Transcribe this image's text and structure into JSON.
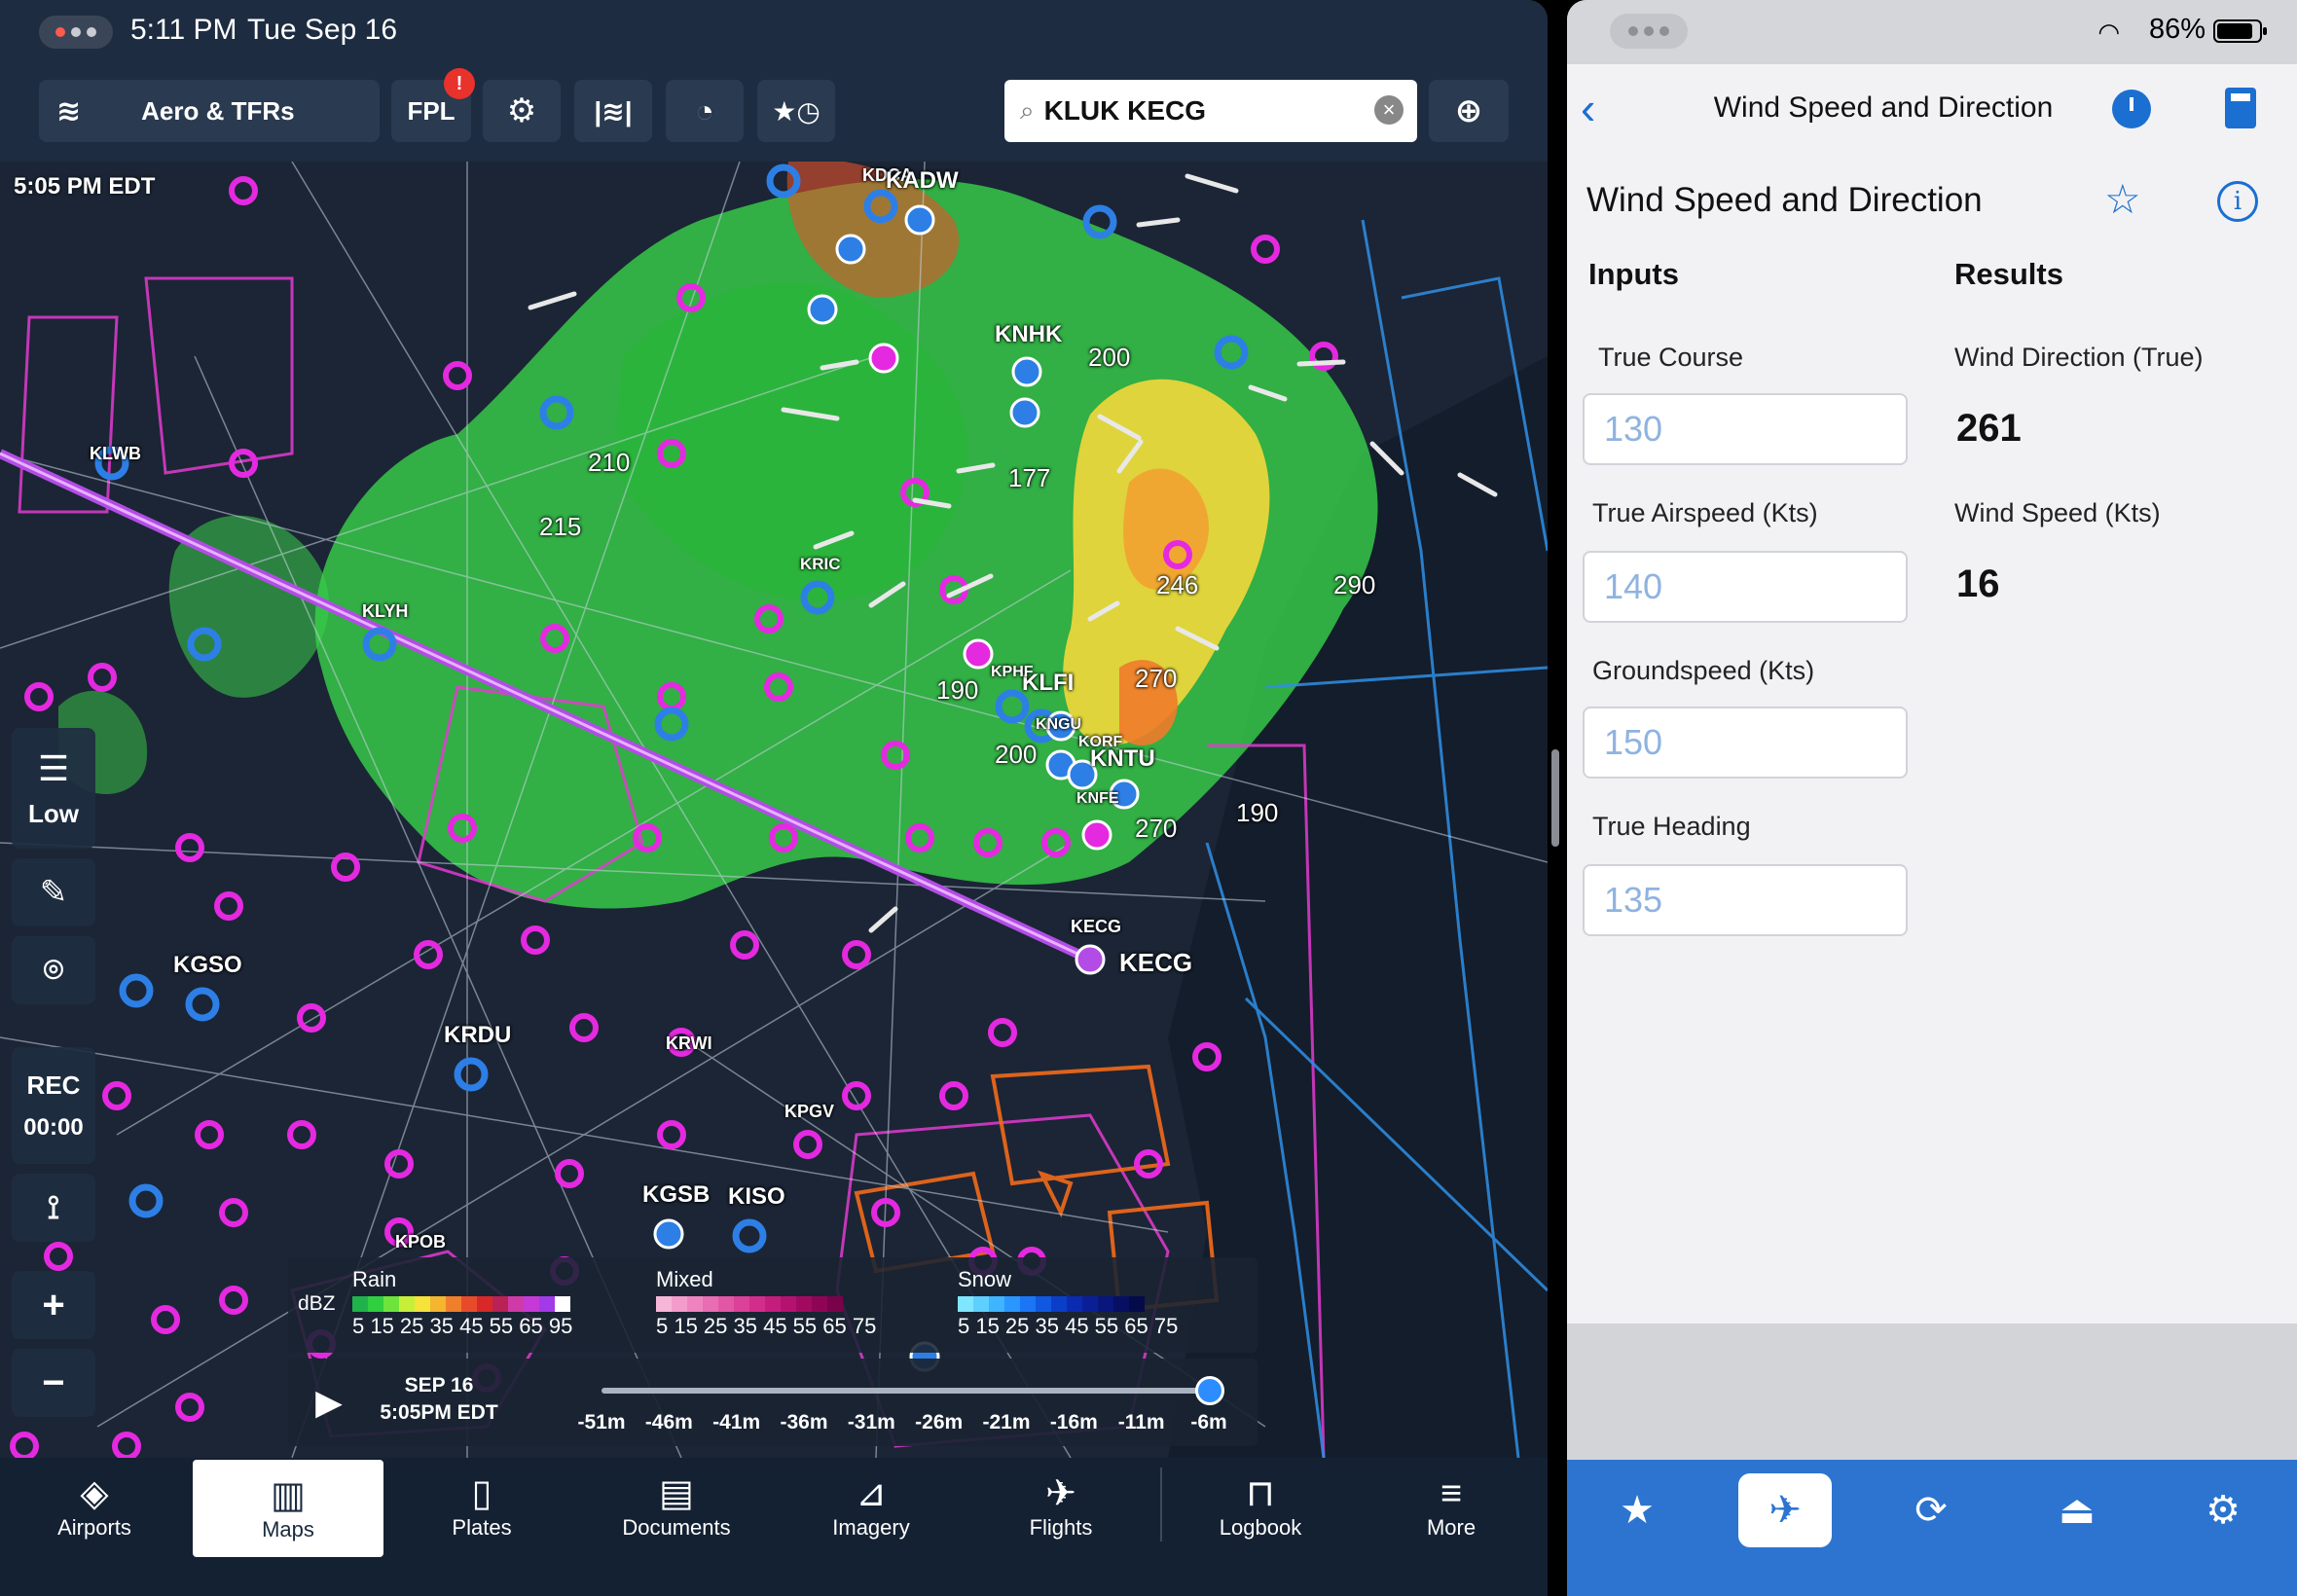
{
  "left_status": {
    "time": "5:11 PM",
    "date": "Tue Sep 16"
  },
  "toolbar": {
    "layers_label": "Aero & TFRs",
    "fpl_label": "FPL",
    "fpl_badge": "!",
    "search_value": "KLUK KECG",
    "search_clear": "×"
  },
  "map": {
    "timestamp": "5:05 PM EDT",
    "labels": {
      "kdca": "KDCA",
      "kadw": "KADW",
      "knhk": "KNHK",
      "krwi": "KRWI",
      "kric": "KRIC",
      "klwb": "KLWB",
      "klyh": "KLYH",
      "kgso": "KGSO",
      "krdu": "KRDU",
      "kecg": "KECG",
      "kecg_small": "KECG",
      "kpgv": "KPGV",
      "kgsb": "KGSB",
      "kiso": "KISO",
      "kpob": "KPOB",
      "klfi": "KLFI",
      "kntu": "KNTU",
      "knfe": "KNFE",
      "korf": "KORF",
      "kngu": "KNGU",
      "kphf": "KPHF",
      "a210": "210",
      "a215": "215",
      "a200": "200",
      "a177": "177",
      "a246": "246",
      "a270": "270",
      "a290": "290",
      "a190a": "190",
      "a200b": "200",
      "a190b": "190",
      "a270b": "270"
    },
    "side_controls": {
      "low": "Low",
      "rec": "REC",
      "rec_time": "00:00",
      "zoom_in": "+",
      "zoom_out": "−"
    }
  },
  "legend": {
    "dbz": "dBZ",
    "rain": {
      "title": "Rain",
      "ticks": "5  15  25  35  45  55  65 95"
    },
    "mixed": {
      "title": "Mixed",
      "ticks": "5  15  25  35  45  55  65 75"
    },
    "snow": {
      "title": "Snow",
      "ticks": "5  15  25  35  45  55  65 75"
    },
    "rain_colors": [
      "#1fb24a",
      "#2fcf3f",
      "#6ee43a",
      "#c7ef3a",
      "#f5e33a",
      "#f4b52f",
      "#ef7f2a",
      "#e84b2a",
      "#d82828",
      "#b82254",
      "#d03aa8",
      "#c53ad6",
      "#a23ae8",
      "#ffffff"
    ],
    "mixed_colors": [
      "#f7b6d8",
      "#f39ccb",
      "#ee84bf",
      "#e86db2",
      "#e257a5",
      "#db4198",
      "#d22d8b",
      "#c51d7d",
      "#b5126f",
      "#a20a61",
      "#8e0556",
      "#7a024b"
    ],
    "snow_colors": [
      "#7fe6ff",
      "#5dd0ff",
      "#3fb4ff",
      "#2a96ff",
      "#1a76f5",
      "#1058e0",
      "#0b3ec8",
      "#0a2bb0",
      "#0a1f96",
      "#09167c",
      "#070f63",
      "#050a4b"
    ]
  },
  "timeline": {
    "date": "SEP 16",
    "time": "5:05PM EDT",
    "ticks": [
      "-51m",
      "-46m",
      "-41m",
      "-36m",
      "-31m",
      "-26m",
      "-21m",
      "-16m",
      "-11m",
      "-6m"
    ]
  },
  "bottom_tabs": [
    {
      "label": "Airports",
      "icon": "airports-icon"
    },
    {
      "label": "Maps",
      "icon": "maps-icon"
    },
    {
      "label": "Plates",
      "icon": "plates-icon"
    },
    {
      "label": "Documents",
      "icon": "documents-icon"
    },
    {
      "label": "Imagery",
      "icon": "imagery-icon"
    },
    {
      "label": "Flights",
      "icon": "flights-icon"
    },
    {
      "label": "Logbook",
      "icon": "logbook-icon"
    },
    {
      "label": "More",
      "icon": "more-icon"
    }
  ],
  "right_status": {
    "battery": "86%"
  },
  "calc": {
    "nav_title": "Wind Speed and Direction",
    "heading": "Wind Speed and Direction",
    "inputs_header": "Inputs",
    "results_header": "Results",
    "inputs": [
      {
        "label": "True Course",
        "value": "130"
      },
      {
        "label": "True Airspeed (Kts)",
        "value": "140"
      },
      {
        "label": "Groundspeed (Kts)",
        "value": "150"
      },
      {
        "label": "True Heading",
        "value": "135"
      }
    ],
    "results": [
      {
        "label": "Wind Direction (True)",
        "value": "261"
      },
      {
        "label": "Wind Speed (Kts)",
        "value": "16"
      }
    ]
  }
}
